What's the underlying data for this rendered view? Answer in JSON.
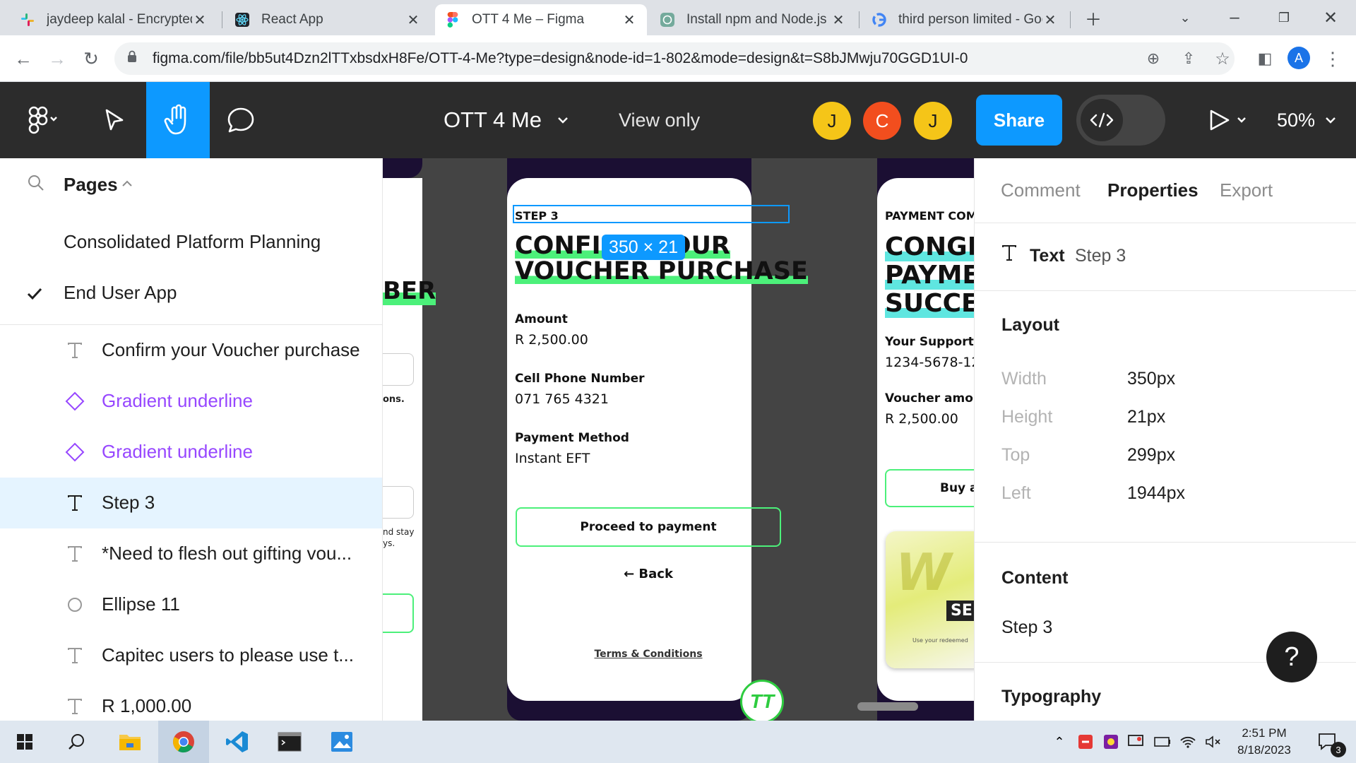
{
  "browser": {
    "tabs": [
      {
        "title": "jaydeep kalal - Encrypted",
        "icon": "slack-icon"
      },
      {
        "title": "React App",
        "icon": "react-icon"
      },
      {
        "title": "OTT 4 Me – Figma",
        "icon": "figma-icon",
        "active": true
      },
      {
        "title": "Install npm and Node.js",
        "icon": "chatgpt-icon"
      },
      {
        "title": "third person limited - Goo",
        "icon": "google-icon"
      }
    ],
    "url": "figma.com/file/bb5ut4Dzn2lTTxbsdxH8Fe/OTT-4-Me?type=design&node-id=1-802&mode=design&t=S8bJMwju70GGD1UI-0",
    "profile_initial": "A"
  },
  "toolbar": {
    "file_name": "OTT 4 Me",
    "mode": "View only",
    "collaborators": [
      {
        "initial": "J",
        "color": "#f5c518"
      },
      {
        "initial": "C",
        "color": "#f24e1e"
      },
      {
        "initial": "J",
        "color": "#f5c518"
      }
    ],
    "share_label": "Share",
    "zoom": "50%"
  },
  "left_panel": {
    "pages_label": "Pages",
    "pages": [
      {
        "name": "Consolidated Platform Planning",
        "current": false
      },
      {
        "name": "End User App",
        "current": true
      }
    ],
    "layers": [
      {
        "name": "Confirm your Voucher purchase",
        "type": "text"
      },
      {
        "name": "Gradient underline",
        "type": "component"
      },
      {
        "name": "Gradient underline",
        "type": "component"
      },
      {
        "name": "Step 3",
        "type": "text",
        "selected": true
      },
      {
        "name": "*Need to flesh out gifting vou...",
        "type": "text"
      },
      {
        "name": "Ellipse 11",
        "type": "ellipse"
      },
      {
        "name": "Capitec users to please use t...",
        "type": "text"
      },
      {
        "name": "R 1,000.00",
        "type": "text"
      }
    ]
  },
  "canvas": {
    "left_frame": {
      "heading_fragment": "BER",
      "text_fragment_1": "ons.",
      "text_fragment_2": "nd stay",
      "text_fragment_3": "ys."
    },
    "center_frame": {
      "step_label": "STEP 3",
      "selection_size": "350 × 21",
      "heading_line1": "CONFIRM YOUR",
      "heading_line2": "VOUCHER PURCHASE",
      "fields": [
        {
          "label": "Amount",
          "value": "R 2,500.00"
        },
        {
          "label": "Cell Phone Number",
          "value": "071 765 4321"
        },
        {
          "label": "Payment Method",
          "value": "Instant EFT"
        }
      ],
      "proceed_label": "Proceed to payment",
      "back_label": "← Back",
      "terms_label": "Terms & Conditions"
    },
    "right_frame": {
      "step_label": "PAYMENT COMP",
      "heading_line1": "CONGR",
      "heading_line2": "PAYME",
      "heading_line3": "SUCCES",
      "support_label": "Your Support",
      "support_value": "1234-5678-12",
      "voucher_label": "Voucher amou",
      "voucher_value": "R 2,500.00",
      "buy_label": "Buy a",
      "card_text": "SE",
      "card_small": "Use your redeemed"
    }
  },
  "right_panel": {
    "tabs": [
      "Comment",
      "Properties",
      "Export"
    ],
    "active_tab": "Properties",
    "element_type": "Text",
    "element_name": "Step 3",
    "layout_title": "Layout",
    "layout": [
      {
        "label": "Width",
        "value": "350px"
      },
      {
        "label": "Height",
        "value": "21px"
      },
      {
        "label": "Top",
        "value": "299px"
      },
      {
        "label": "Left",
        "value": "1944px"
      }
    ],
    "content_title": "Content",
    "content_value": "Step 3",
    "typography_title": "Typography",
    "help_label": "?"
  },
  "taskbar": {
    "time": "2:51 PM",
    "date": "8/18/2023",
    "notification_count": "3"
  }
}
